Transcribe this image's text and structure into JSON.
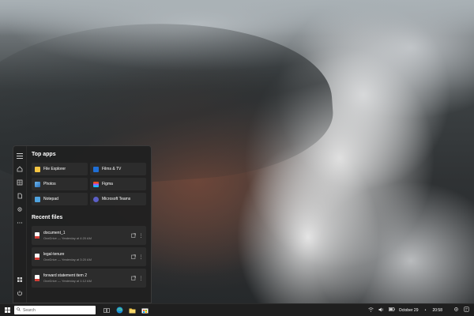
{
  "start_menu": {
    "top_apps_title": "Top apps",
    "apps": [
      {
        "label": "File Explorer",
        "icon": "folder-icon",
        "color": "#f4c542"
      },
      {
        "label": "Films & TV",
        "icon": "films-tv-icon",
        "color": "#1f6fd6"
      },
      {
        "label": "Photos",
        "icon": "photos-icon",
        "color": "#2a8ad8"
      },
      {
        "label": "Figma",
        "icon": "figma-icon",
        "color": "#a259ff"
      },
      {
        "label": "Notepad",
        "icon": "notepad-icon",
        "color": "#4fa3e0"
      },
      {
        "label": "Microsoft Teams",
        "icon": "teams-icon",
        "color": "#5b5fc7"
      }
    ],
    "recent_files_title": "Recent files",
    "files": [
      {
        "name": "document_1",
        "meta": "OneDrive — Yesterday at 4:20 AM"
      },
      {
        "name": "legal-tenure",
        "meta": "OneDrive — Yesterday at 3:20 AM"
      },
      {
        "name": "forward statement item 2",
        "meta": "OneDrive — Yesterday at 1:12 AM"
      }
    ]
  },
  "taskbar": {
    "search_placeholder": "Search",
    "date": "October 29",
    "time": "20:58"
  }
}
